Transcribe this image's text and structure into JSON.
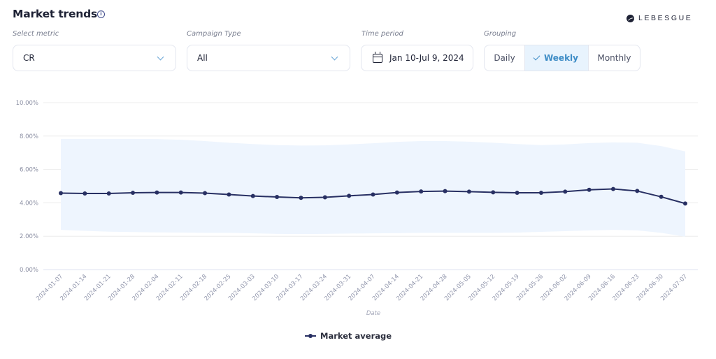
{
  "header": {
    "title": "Market trends",
    "info_icon": "info-icon",
    "brand": "LEBESGUE"
  },
  "filters": {
    "metric": {
      "label": "Select metric",
      "value": "CR"
    },
    "campaign_type": {
      "label": "Campaign Type",
      "value": "All"
    },
    "time_period": {
      "label": "Time period",
      "value": "Jan 10-Jul 9, 2024",
      "icon": "calendar-icon"
    },
    "grouping": {
      "label": "Grouping",
      "options": [
        "Daily",
        "Weekly",
        "Monthly"
      ],
      "selected": "Weekly"
    }
  },
  "colors": {
    "line": "#283063",
    "band": "#eef5fe",
    "grid": "#ececec",
    "accent": "#3d8cc6"
  },
  "chart_data": {
    "type": "line",
    "title": "",
    "xlabel": "Date",
    "ylabel": "",
    "ylim": [
      0,
      10
    ],
    "yticks": [
      "0.00%",
      "2.00%",
      "4.00%",
      "6.00%",
      "8.00%",
      "10.00%"
    ],
    "ytick_values": [
      0,
      2,
      4,
      6,
      8,
      10
    ],
    "grid": true,
    "legend_position": "bottom",
    "x": [
      "2024-01-07",
      "2024-01-14",
      "2024-01-21",
      "2024-01-28",
      "2024-02-04",
      "2024-02-11",
      "2024-02-18",
      "2024-02-25",
      "2024-03-03",
      "2024-03-10",
      "2024-03-17",
      "2024-03-24",
      "2024-03-31",
      "2024-04-07",
      "2024-04-14",
      "2024-04-21",
      "2024-04-28",
      "2024-05-05",
      "2024-05-12",
      "2024-05-19",
      "2024-05-26",
      "2024-06-02",
      "2024-06-09",
      "2024-06-16",
      "2024-06-23",
      "2024-06-30",
      "2024-07-07"
    ],
    "series": [
      {
        "name": "Market average",
        "values": [
          4.58,
          4.56,
          4.56,
          4.6,
          4.62,
          4.62,
          4.58,
          4.5,
          4.41,
          4.35,
          4.3,
          4.33,
          4.42,
          4.5,
          4.62,
          4.68,
          4.7,
          4.67,
          4.63,
          4.6,
          4.6,
          4.67,
          4.78,
          4.83,
          4.71,
          4.36,
          3.96
        ]
      }
    ],
    "band": {
      "upper": [
        7.83,
        7.83,
        7.83,
        7.83,
        7.82,
        7.78,
        7.7,
        7.6,
        7.52,
        7.46,
        7.43,
        7.44,
        7.5,
        7.57,
        7.65,
        7.7,
        7.7,
        7.66,
        7.6,
        7.52,
        7.46,
        7.5,
        7.58,
        7.62,
        7.6,
        7.4,
        7.08
      ],
      "lower": [
        2.38,
        2.32,
        2.27,
        2.25,
        2.23,
        2.22,
        2.2,
        2.2,
        2.17,
        2.14,
        2.13,
        2.14,
        2.16,
        2.17,
        2.18,
        2.2,
        2.2,
        2.2,
        2.2,
        2.22,
        2.26,
        2.3,
        2.35,
        2.38,
        2.35,
        2.2,
        1.97
      ]
    }
  }
}
